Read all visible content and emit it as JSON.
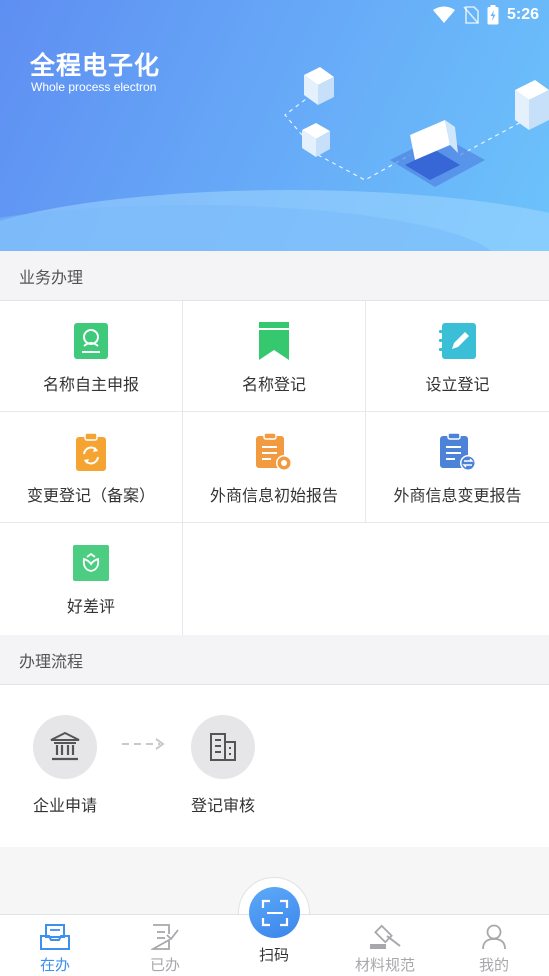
{
  "status_bar": {
    "time": "5:26"
  },
  "banner": {
    "title": "全程电子化",
    "subtitle": "Whole process electron"
  },
  "business": {
    "header": "业务办理",
    "items": [
      {
        "label": "名称自主申报",
        "icon": "id-card-icon",
        "color": "#3fc97a"
      },
      {
        "label": "名称登记",
        "icon": "bookmark-icon",
        "color": "#35c86f"
      },
      {
        "label": "设立登记",
        "icon": "edit-notebook-icon",
        "color": "#3bbfd6"
      },
      {
        "label": "变更登记（备案）",
        "icon": "refresh-clipboard-icon",
        "color": "#f5a331"
      },
      {
        "label": "外商信息初始报告",
        "icon": "report-initial-icon",
        "color": "#f29a3f"
      },
      {
        "label": "外商信息变更报告",
        "icon": "report-change-icon",
        "color": "#4c82d8"
      },
      {
        "label": "好差评",
        "icon": "flower-icon",
        "color": "#4ccd81"
      }
    ]
  },
  "process": {
    "header": "办理流程",
    "steps": [
      {
        "label": "企业申请",
        "icon": "bank-icon"
      },
      {
        "label": "登记审核",
        "icon": "building-icon"
      }
    ]
  },
  "tabbar": {
    "items": [
      {
        "label": "在办",
        "icon": "inbox-icon",
        "active": true
      },
      {
        "label": "已办",
        "icon": "done-doc-icon",
        "active": false
      },
      {
        "label": "扫码",
        "icon": "scan-icon",
        "active": false
      },
      {
        "label": "材料规范",
        "icon": "gavel-icon",
        "active": false
      },
      {
        "label": "我的",
        "icon": "user-icon",
        "active": false
      }
    ],
    "accent": "#3d8ff0"
  }
}
